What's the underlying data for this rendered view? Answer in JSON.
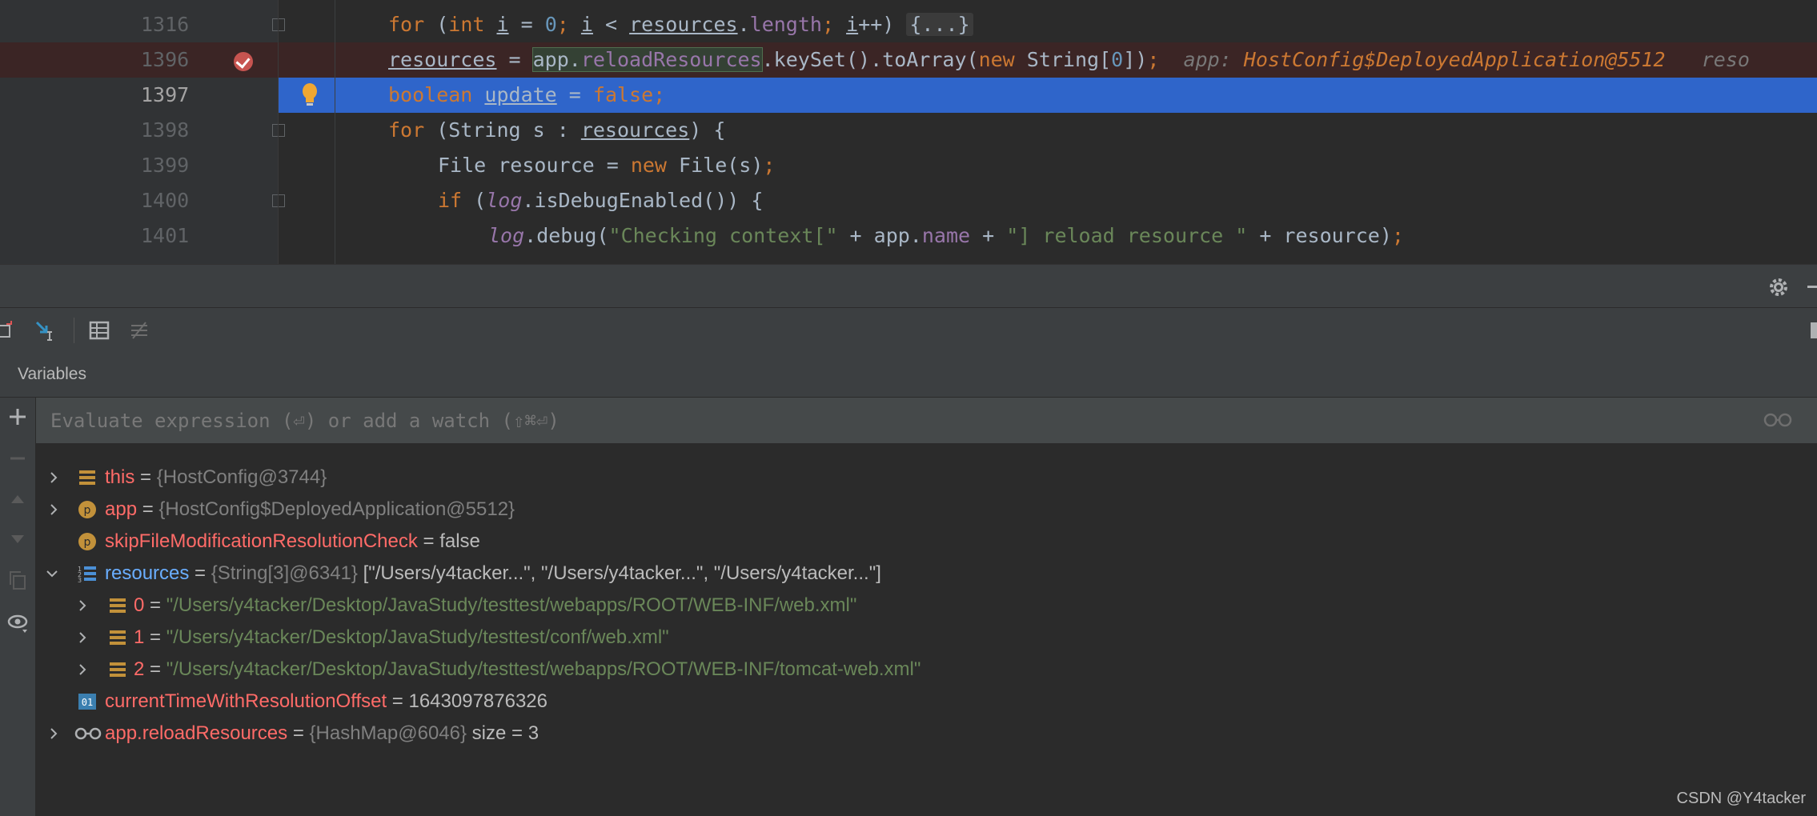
{
  "editor": {
    "lines": [
      {
        "num": "1316",
        "code": "for (int i = 0; i < resources.length; i++) {...}"
      },
      {
        "num": "1396",
        "code": "resources = app.reloadResources.keySet().toArray(new String[0]);",
        "hint_label": "app:",
        "hint_value": "HostConfig$DeployedApplication@5512",
        "hint_trail": "reso"
      },
      {
        "num": "1397",
        "code": "boolean update = false;"
      },
      {
        "num": "1398",
        "code": "for (String s : resources) {"
      },
      {
        "num": "1399",
        "code": "File resource = new File(s);"
      },
      {
        "num": "1400",
        "code": "if (log.isDebugEnabled()) {"
      },
      {
        "num": "1401",
        "code": "log.debug(\"Checking context[\" + app.name + \"] reload resource \" + resource);"
      }
    ]
  },
  "debugger": {
    "panel_title": "Variables",
    "eval_placeholder": "Evaluate expression (⏎) or add a watch (⇧⌘⏎)",
    "variables": [
      {
        "name": "this",
        "eq": "=",
        "type": "{HostConfig@3744}",
        "value": "",
        "icon": "field-icon",
        "expanded": false
      },
      {
        "name": "app",
        "eq": "=",
        "type": "{HostConfig$DeployedApplication@5512}",
        "value": "",
        "icon": "parameter-icon",
        "expanded": false
      },
      {
        "name": "skipFileModificationResolutionCheck",
        "eq": "=",
        "type": "",
        "value": "false",
        "icon": "parameter-icon"
      },
      {
        "name": "resources",
        "eq": "=",
        "type": "{String[3]@6341}",
        "value": "[\"/Users/y4tacker...\", \"/Users/y4tacker...\", \"/Users/y4tacker...\"]",
        "icon": "array-icon",
        "expanded": true
      },
      {
        "name": "0",
        "eq": "=",
        "value": "\"/Users/y4tacker/Desktop/JavaStudy/testtest/webapps/ROOT/WEB-INF/web.xml\"",
        "icon": "field-icon"
      },
      {
        "name": "1",
        "eq": "=",
        "value": "\"/Users/y4tacker/Desktop/JavaStudy/testtest/conf/web.xml\"",
        "icon": "field-icon"
      },
      {
        "name": "2",
        "eq": "=",
        "value": "\"/Users/y4tacker/Desktop/JavaStudy/testtest/webapps/ROOT/WEB-INF/tomcat-web.xml\"",
        "icon": "field-icon"
      },
      {
        "name": "currentTimeWithResolutionOffset",
        "eq": "=",
        "type": "",
        "value": "1643097876326",
        "icon": "primitive-icon"
      },
      {
        "name": "app.reloadResources",
        "eq": "=",
        "type": "{HashMap@6046}",
        "value": "size = 3",
        "icon": "watch-icon",
        "expanded": false
      }
    ]
  },
  "watermark": "CSDN @Y4tacker"
}
